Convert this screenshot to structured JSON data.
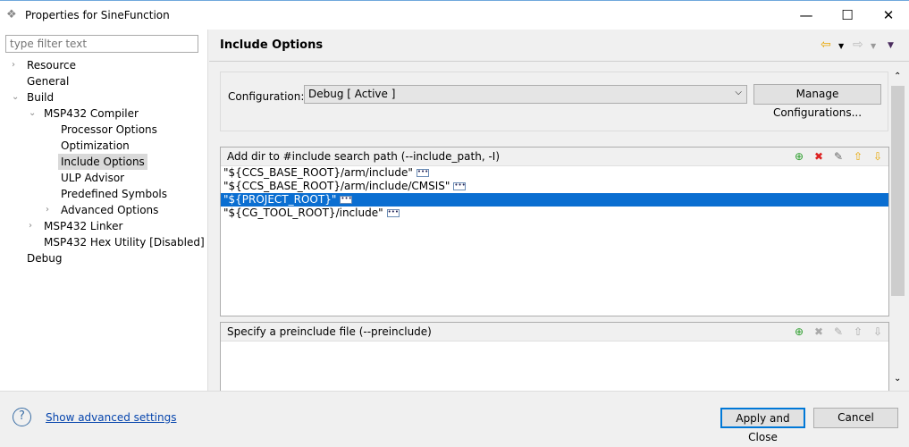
{
  "window": {
    "title": "Properties for SineFunction",
    "minimize": "—",
    "maximize": "☐",
    "close": "✕"
  },
  "sidebar": {
    "filter_placeholder": "type filter text",
    "items": [
      {
        "label": "Resource",
        "level": 0,
        "twisty": "›"
      },
      {
        "label": "General",
        "level": 0,
        "twisty": ""
      },
      {
        "label": "Build",
        "level": 0,
        "twisty": "⌄"
      },
      {
        "label": "MSP432 Compiler",
        "level": 1,
        "twisty": "⌄"
      },
      {
        "label": "Processor Options",
        "level": 2,
        "twisty": ""
      },
      {
        "label": "Optimization",
        "level": 2,
        "twisty": ""
      },
      {
        "label": "Include Options",
        "level": 2,
        "twisty": "",
        "selected": true
      },
      {
        "label": "ULP Advisor",
        "level": 2,
        "twisty": ""
      },
      {
        "label": "Predefined Symbols",
        "level": 2,
        "twisty": ""
      },
      {
        "label": "Advanced Options",
        "level": 2,
        "twisty": "›"
      },
      {
        "label": "MSP432 Linker",
        "level": 1,
        "twisty": "›"
      },
      {
        "label": "MSP432 Hex Utility  [Disabled]",
        "level": 1,
        "twisty": ""
      },
      {
        "label": "Debug",
        "level": 0,
        "twisty": ""
      }
    ]
  },
  "main": {
    "title": "Include Options",
    "configuration": {
      "label": "Configuration:",
      "value": "Debug  [ Active ]",
      "manage_button": "Manage Configurations..."
    },
    "include_path": {
      "header": "Add dir to #include search path (--include_path, -I)",
      "entries": [
        "\"${CCS_BASE_ROOT}/arm/include\"",
        "\"${CCS_BASE_ROOT}/arm/include/CMSIS\"",
        "\"${PROJECT_ROOT}\"",
        "\"${CG_TOOL_ROOT}/include\""
      ],
      "selected_index": 2
    },
    "preinclude": {
      "header": "Specify a preinclude file (--preinclude)"
    }
  },
  "footer": {
    "help": "?",
    "show_advanced": "Show advanced settings",
    "apply_close": "Apply and Close",
    "cancel": "Cancel"
  }
}
